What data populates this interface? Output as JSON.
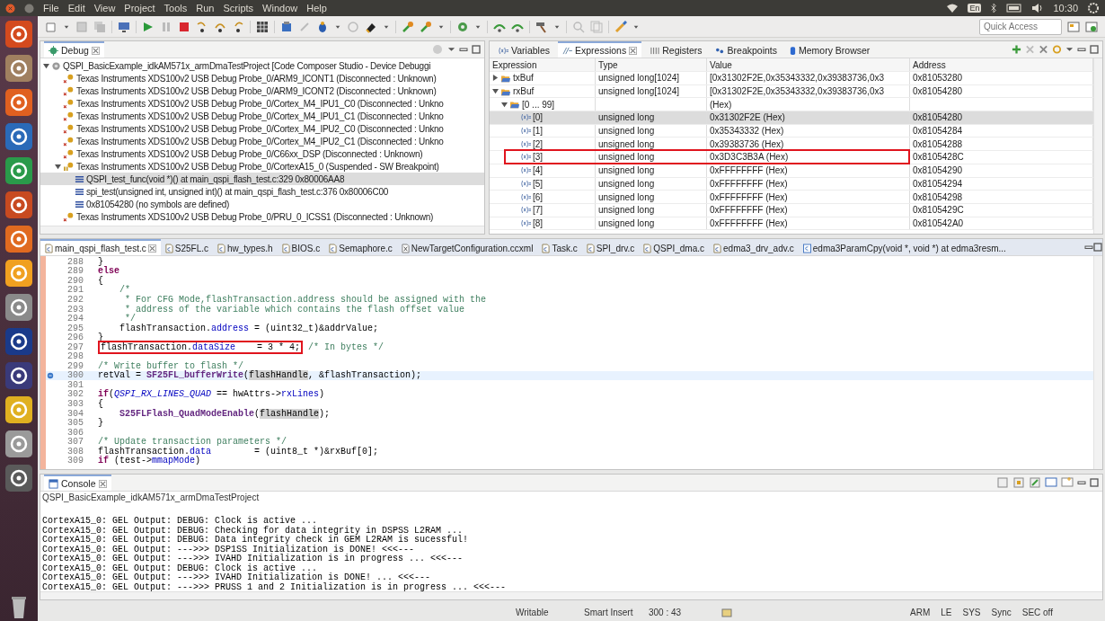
{
  "menu_bar": {
    "items": [
      "File",
      "Edit",
      "View",
      "Project",
      "Tools",
      "Run",
      "Scripts",
      "Window",
      "Help"
    ],
    "keyboard_layout": "En",
    "clock": "10:30"
  },
  "search": {
    "placeholder": "Quick Access"
  },
  "debug_view": {
    "tab": "Debug",
    "tree": [
      {
        "label": "QSPI_BasicExample_idkAM571x_armDmaTestProject [Code Composer Studio - Device Debuggi",
        "kind": "session",
        "expanded": true,
        "selected": false,
        "children": [
          {
            "label": "Texas Instruments XDS100v2 USB Debug Probe_0/ARM9_ICONT1 (Disconnected : Unknown)",
            "kind": "core-disconnected",
            "selected": false
          },
          {
            "label": "Texas Instruments XDS100v2 USB Debug Probe_0/ARM9_ICONT2 (Disconnected : Unknown)",
            "kind": "core-disconnected",
            "selected": false
          },
          {
            "label": "Texas Instruments XDS100v2 USB Debug Probe_0/Cortex_M4_IPU1_C0 (Disconnected : Unkno",
            "kind": "core-disconnected",
            "selected": false
          },
          {
            "label": "Texas Instruments XDS100v2 USB Debug Probe_0/Cortex_M4_IPU1_C1 (Disconnected : Unkno",
            "kind": "core-disconnected",
            "selected": false
          },
          {
            "label": "Texas Instruments XDS100v2 USB Debug Probe_0/Cortex_M4_IPU2_C0 (Disconnected : Unkno",
            "kind": "core-disconnected",
            "selected": false
          },
          {
            "label": "Texas Instruments XDS100v2 USB Debug Probe_0/Cortex_M4_IPU2_C1 (Disconnected : Unkno",
            "kind": "core-disconnected",
            "selected": false
          },
          {
            "label": "Texas Instruments XDS100v2 USB Debug Probe_0/C66xx_DSP (Disconnected : Unknown)",
            "kind": "core-disconnected",
            "selected": false
          },
          {
            "label": "Texas Instruments XDS100v2 USB Debug Probe_0/CortexA15_0 (Suspended - SW Breakpoint)",
            "kind": "core-suspended",
            "expanded": true,
            "selected": false,
            "children": [
              {
                "label": "QSPI_test_func(void *)() at main_qspi_flash_test.c:329 0x80006AA8",
                "kind": "frame",
                "selected": true
              },
              {
                "label": "spi_test(unsigned int, unsigned int)() at main_qspi_flash_test.c:376 0x80006C00",
                "kind": "frame",
                "selected": false
              },
              {
                "label": "0x81054280  (no symbols are defined)",
                "kind": "frame",
                "selected": false
              }
            ]
          },
          {
            "label": "Texas Instruments XDS100v2 USB Debug Probe_0/PRU_0_ICSS1 (Disconnected : Unknown)",
            "kind": "core-disconnected",
            "selected": false
          }
        ]
      }
    ]
  },
  "expressions_view": {
    "tabs": [
      {
        "label": "Variables",
        "kind": "variables",
        "selected": false
      },
      {
        "label": "Expressions",
        "kind": "expressions",
        "selected": true
      },
      {
        "label": "Registers",
        "kind": "registers",
        "selected": false
      },
      {
        "label": "Breakpoints",
        "kind": "breakpoints",
        "selected": false
      },
      {
        "label": "Memory Browser",
        "kind": "memory",
        "selected": false
      }
    ],
    "columns": [
      "Expression",
      "Type",
      "Value",
      "Address"
    ],
    "rows": [
      {
        "expression": "txBuf",
        "kind": "array",
        "type": "unsigned long[1024]",
        "value": "[0x31302F2E,0x35343332,0x39383736,0x3",
        "address": "0x81053280",
        "expanded": false,
        "selected": false,
        "annotated": false
      },
      {
        "expression": "rxBuf",
        "kind": "array",
        "type": "unsigned long[1024]",
        "value": "[0x31302F2E,0x35343332,0x39383736,0x3",
        "address": "0x81054280",
        "expanded": true,
        "selected": false,
        "annotated": false,
        "children": [
          {
            "expression": "[0 ... 99]",
            "kind": "array",
            "value": "(Hex)",
            "expanded": true,
            "selected": false,
            "annotated": false,
            "children": [
              {
                "expression": "[0]",
                "kind": "element",
                "type": "unsigned long",
                "value": "0x31302F2E (Hex)",
                "address": "0x81054280",
                "selected": true,
                "annotated": false
              },
              {
                "expression": "[1]",
                "kind": "element",
                "type": "unsigned long",
                "value": "0x35343332 (Hex)",
                "address": "0x81054284",
                "selected": false,
                "annotated": false
              },
              {
                "expression": "[2]",
                "kind": "element",
                "type": "unsigned long",
                "value": "0x39383736 (Hex)",
                "address": "0x81054288",
                "selected": false,
                "annotated": false
              },
              {
                "expression": "[3]",
                "kind": "element",
                "type": "unsigned long",
                "value": "0x3D3C3B3A (Hex)",
                "address": "0x8105428C",
                "selected": false,
                "annotated": true
              },
              {
                "expression": "[4]",
                "kind": "element",
                "type": "unsigned long",
                "value": "0xFFFFFFFF (Hex)",
                "address": "0x81054290",
                "selected": false,
                "annotated": false
              },
              {
                "expression": "[5]",
                "kind": "element",
                "type": "unsigned long",
                "value": "0xFFFFFFFF (Hex)",
                "address": "0x81054294",
                "selected": false,
                "annotated": false
              },
              {
                "expression": "[6]",
                "kind": "element",
                "type": "unsigned long",
                "value": "0xFFFFFFFF (Hex)",
                "address": "0x81054298",
                "selected": false,
                "annotated": false
              },
              {
                "expression": "[7]",
                "kind": "element",
                "type": "unsigned long",
                "value": "0xFFFFFFFF (Hex)",
                "address": "0x8105429C",
                "selected": false,
                "annotated": false
              },
              {
                "expression": "[8]",
                "kind": "element",
                "type": "unsigned long",
                "value": "0xFFFFFFFF (Hex)",
                "address": "0x810542A0",
                "selected": false,
                "annotated": false
              }
            ]
          }
        ]
      }
    ]
  },
  "editor": {
    "tabs": [
      {
        "label": "main_qspi_flash_test.c",
        "kind": "source",
        "selected": true
      },
      {
        "label": "S25FL.c",
        "kind": "source",
        "selected": false
      },
      {
        "label": "hw_types.h",
        "kind": "source",
        "selected": false
      },
      {
        "label": "BIOS.c",
        "kind": "source",
        "selected": false
      },
      {
        "label": "Semaphore.c",
        "kind": "source",
        "selected": false
      },
      {
        "label": "NewTargetConfiguration.ccxml",
        "kind": "config",
        "selected": false
      },
      {
        "label": "Task.c",
        "kind": "source",
        "selected": false
      },
      {
        "label": "SPI_drv.c",
        "kind": "source",
        "selected": false
      },
      {
        "label": "QSPI_dma.c",
        "kind": "source",
        "selected": false
      },
      {
        "label": "edma3_drv_adv.c",
        "kind": "source",
        "selected": false
      },
      {
        "label": "edma3ParamCpy(void *, void *) at edma3resm...",
        "kind": "frame",
        "selected": false
      }
    ],
    "lines": [
      {
        "number": "288",
        "current": false,
        "segments": [
          {
            "text": "}",
            "kind": "plain"
          }
        ]
      },
      {
        "number": "289",
        "current": false,
        "segments": [
          {
            "text": "else",
            "kind": "keyword"
          }
        ]
      },
      {
        "number": "290",
        "current": false,
        "segments": [
          {
            "text": "{",
            "kind": "plain"
          }
        ]
      },
      {
        "number": "291",
        "current": false,
        "segments": [
          {
            "text": "    /*",
            "kind": "comment"
          }
        ]
      },
      {
        "number": "292",
        "current": false,
        "segments": [
          {
            "text": "     * For CFG Mode,flashTransaction.address should be assigned with the",
            "kind": "comment"
          }
        ]
      },
      {
        "number": "293",
        "current": false,
        "segments": [
          {
            "text": "     * address of the variable which contains the flash offset value",
            "kind": "comment"
          }
        ]
      },
      {
        "number": "294",
        "current": false,
        "segments": [
          {
            "text": "     */",
            "kind": "comment"
          }
        ]
      },
      {
        "number": "295",
        "current": false,
        "segments": [
          {
            "text": "    flashTransaction.",
            "kind": "plain"
          },
          {
            "text": "address",
            "kind": "field"
          },
          {
            "text": " = (uint32_t)&addrValue;",
            "kind": "plain"
          }
        ]
      },
      {
        "number": "296",
        "current": false,
        "segments": [
          {
            "text": "}",
            "kind": "plain"
          }
        ]
      },
      {
        "number": "297",
        "current": false,
        "segments": [
          {
            "text": "flashTransaction.",
            "kind": "plain",
            "annotated": true
          },
          {
            "text": "dataSize",
            "kind": "field",
            "annotated": true
          },
          {
            "text": "    = 3 * 4;",
            "kind": "plain",
            "annotated": true
          },
          {
            "text": " /* In bytes */",
            "kind": "comment",
            "annotated": false
          }
        ]
      },
      {
        "number": "298",
        "current": false
      },
      {
        "number": "299",
        "current": false,
        "segments": [
          {
            "text": "/* Write buffer to flash */",
            "kind": "comment"
          }
        ]
      },
      {
        "number": "300",
        "current": true,
        "segments": [
          {
            "text": "retVal = ",
            "kind": "plain"
          },
          {
            "text": "SF25FL_bufferWrite",
            "kind": "function"
          },
          {
            "text": "(",
            "kind": "plain"
          },
          {
            "text": "flashHandle",
            "kind": "occurrence"
          },
          {
            "text": ", &flashTransaction);",
            "kind": "plain"
          }
        ]
      },
      {
        "number": "301",
        "current": false
      },
      {
        "number": "302",
        "current": false,
        "segments": [
          {
            "text": "if",
            "kind": "keyword"
          },
          {
            "text": "(",
            "kind": "plain"
          },
          {
            "text": "QSPI_RX_LINES_QUAD",
            "kind": "macro"
          },
          {
            "text": " == hwAttrs->",
            "kind": "plain"
          },
          {
            "text": "rxLines",
            "kind": "field"
          },
          {
            "text": ")",
            "kind": "plain"
          }
        ]
      },
      {
        "number": "303",
        "current": false,
        "segments": [
          {
            "text": "{",
            "kind": "plain"
          }
        ]
      },
      {
        "number": "304",
        "current": false,
        "segments": [
          {
            "text": "    S25FLFlash_QuadModeEnable",
            "kind": "function"
          },
          {
            "text": "(",
            "kind": "plain"
          },
          {
            "text": "flashHandle",
            "kind": "occurrence"
          },
          {
            "text": ");",
            "kind": "plain"
          }
        ]
      },
      {
        "number": "305",
        "current": false,
        "segments": [
          {
            "text": "}",
            "kind": "plain"
          }
        ]
      },
      {
        "number": "306",
        "current": false
      },
      {
        "number": "307",
        "current": false,
        "segments": [
          {
            "text": "/* Update transaction parameters */",
            "kind": "comment"
          }
        ]
      },
      {
        "number": "308",
        "current": false,
        "segments": [
          {
            "text": "flashTransaction.",
            "kind": "plain"
          },
          {
            "text": "data",
            "kind": "field"
          },
          {
            "text": "        = (uint8_t *)&rxBuf[0];",
            "kind": "plain"
          }
        ]
      },
      {
        "number": "309",
        "current": false,
        "segments": [
          {
            "text": "if",
            "kind": "keyword"
          },
          {
            "text": " (test->",
            "kind": "plain"
          },
          {
            "text": "mmapMode",
            "kind": "field"
          },
          {
            "text": ")",
            "kind": "plain"
          }
        ]
      }
    ]
  },
  "console": {
    "tab": "Console",
    "title": "QSPI_BasicExample_idkAM571x_armDmaTestProject",
    "lines": [
      "CortexA15_0: GEL Output: DEBUG: Clock is active ...",
      "CortexA15_0: GEL Output: DEBUG: Checking for data integrity in DSPSS L2RAM ...",
      "CortexA15_0: GEL Output: DEBUG: Data integrity check in GEM L2RAM is sucessful!",
      "CortexA15_0: GEL Output: --->>> DSP1SS Initialization is DONE! <<<---",
      "CortexA15_0: GEL Output: --->>> IVAHD Initialization is in progress ... <<<---",
      "CortexA15_0: GEL Output: DEBUG: Clock is active ...",
      "CortexA15_0: GEL Output: --->>> IVAHD Initialization is DONE! ... <<<---",
      "CortexA15_0: GEL Output: --->>> PRUSS 1 and 2 Initialization is in progress ... <<<---"
    ]
  },
  "status_bar": {
    "mode": "Writable",
    "insert": "Smart Insert",
    "position": "300 : 43",
    "indicators": [
      "ARM",
      "LE",
      "SYS",
      "Sync",
      "SEC off"
    ]
  }
}
